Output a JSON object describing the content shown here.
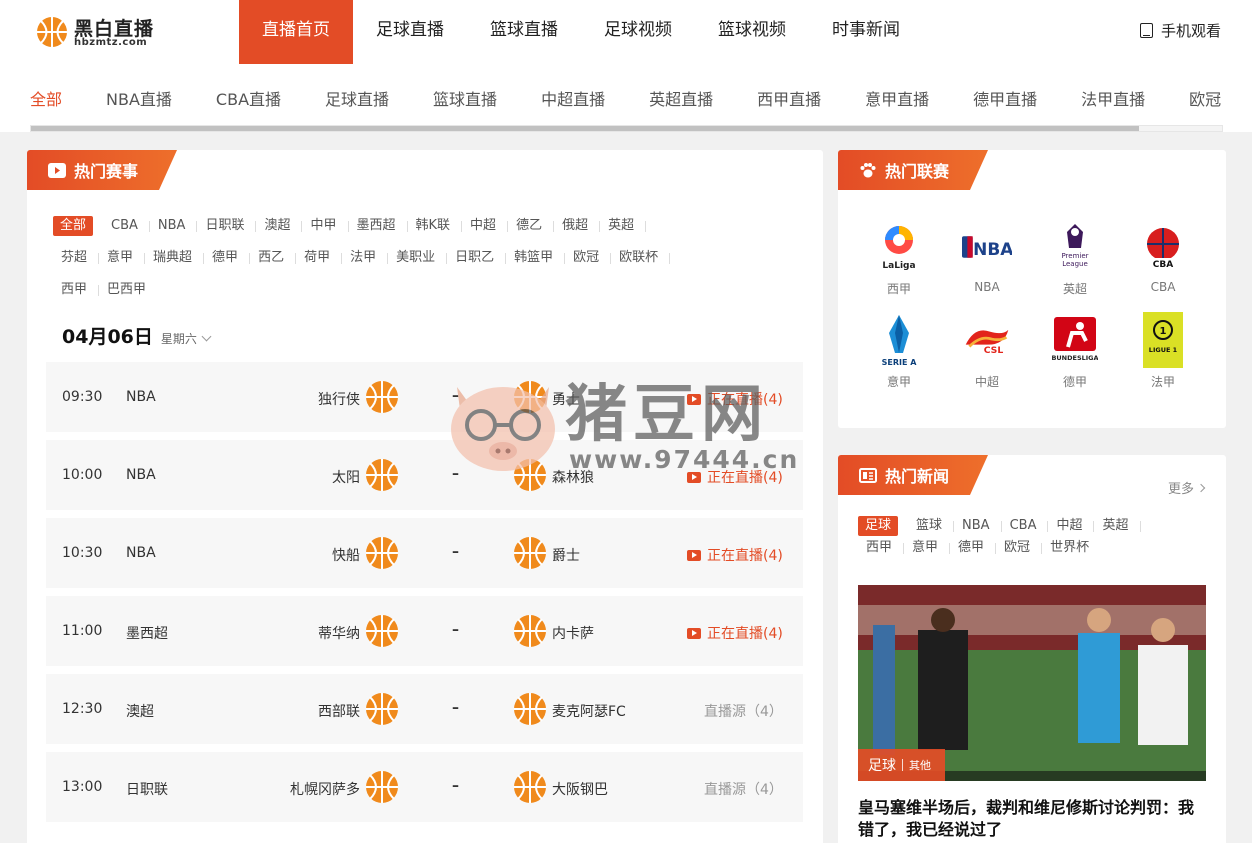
{
  "header": {
    "logo_title": "黑白直播",
    "logo_sub": "hbzmtz.com",
    "nav": [
      "直播首页",
      "足球直播",
      "篮球直播",
      "足球视频",
      "篮球视频",
      "时事新闻"
    ],
    "mobile_label": "手机观看"
  },
  "subnav": [
    "全部",
    "NBA直播",
    "CBA直播",
    "足球直播",
    "篮球直播",
    "中超直播",
    "英超直播",
    "西甲直播",
    "意甲直播",
    "德甲直播",
    "法甲直播",
    "欧冠"
  ],
  "hot_events": {
    "title": "热门赛事",
    "filters_row1": [
      "全部",
      "CBA",
      "NBA",
      "日职联",
      "澳超",
      "中甲",
      "墨西超",
      "韩K联",
      "中超",
      "德乙",
      "俄超",
      "英超"
    ],
    "filters_row2": [
      "芬超",
      "意甲",
      "瑞典超",
      "德甲",
      "西乙",
      "荷甲",
      "法甲",
      "美职业",
      "日职乙",
      "韩篮甲",
      "欧冠",
      "欧联杯"
    ],
    "filters_row3": [
      "西甲",
      "巴西甲"
    ],
    "date": "04月06日",
    "weekday": "星期六",
    "matches": [
      {
        "time": "09:30",
        "league": "NBA",
        "home": "独行侠",
        "away": "勇士",
        "status": "正在直播(4)",
        "live": true
      },
      {
        "time": "10:00",
        "league": "NBA",
        "home": "太阳",
        "away": "森林狼",
        "status": "正在直播(4)",
        "live": true
      },
      {
        "time": "10:30",
        "league": "NBA",
        "home": "快船",
        "away": "爵士",
        "status": "正在直播(4)",
        "live": true
      },
      {
        "time": "11:00",
        "league": "墨西超",
        "home": "蒂华纳",
        "away": "内卡萨",
        "status": "正在直播(4)",
        "live": true
      },
      {
        "time": "12:30",
        "league": "澳超",
        "home": "西部联",
        "away": "麦克阿瑟FC",
        "status": "直播源（4）",
        "live": false
      },
      {
        "time": "13:00",
        "league": "日职联",
        "home": "札幌冈萨多",
        "away": "大阪钢巴",
        "status": "直播源（4）",
        "live": false
      }
    ],
    "dash": "–"
  },
  "hot_leagues": {
    "title": "热门联赛",
    "leagues": [
      {
        "name": "西甲",
        "logo_text": "LaLiga",
        "icon": "laliga-icon"
      },
      {
        "name": "NBA",
        "logo_text": "NBA",
        "icon": "nba-icon"
      },
      {
        "name": "英超",
        "logo_text": "Premier League",
        "icon": "premier-league-icon"
      },
      {
        "name": "CBA",
        "logo_text": "CBA",
        "icon": "cba-icon"
      },
      {
        "name": "意甲",
        "logo_text": "SERIE A",
        "icon": "serie-a-icon"
      },
      {
        "name": "中超",
        "logo_text": "CSL",
        "icon": "csl-icon"
      },
      {
        "name": "德甲",
        "logo_text": "BUNDESLIGA",
        "icon": "bundesliga-icon"
      },
      {
        "name": "法甲",
        "logo_text": "LIGUE 1",
        "icon": "ligue1-icon"
      }
    ]
  },
  "hot_news": {
    "title": "热门新闻",
    "more": "更多",
    "filters_row1": [
      "足球",
      "篮球",
      "NBA",
      "CBA",
      "中超",
      "英超"
    ],
    "filters_row2": [
      "西甲",
      "意甲",
      "德甲",
      "欧冠",
      "世界杯"
    ],
    "badge_main": "足球",
    "badge_sub": "其他",
    "headline": "皇马塞维半场后，裁判和维尼修斯讨论判罚：我错了，我已经说过了"
  },
  "watermark": {
    "text": "猪豆网",
    "url": "www.97444.cn"
  },
  "colors": {
    "accent": "#e34c26",
    "accent2": "#ee6f2b",
    "ball": "#f08a1c",
    "background": "#f1f1f1"
  }
}
